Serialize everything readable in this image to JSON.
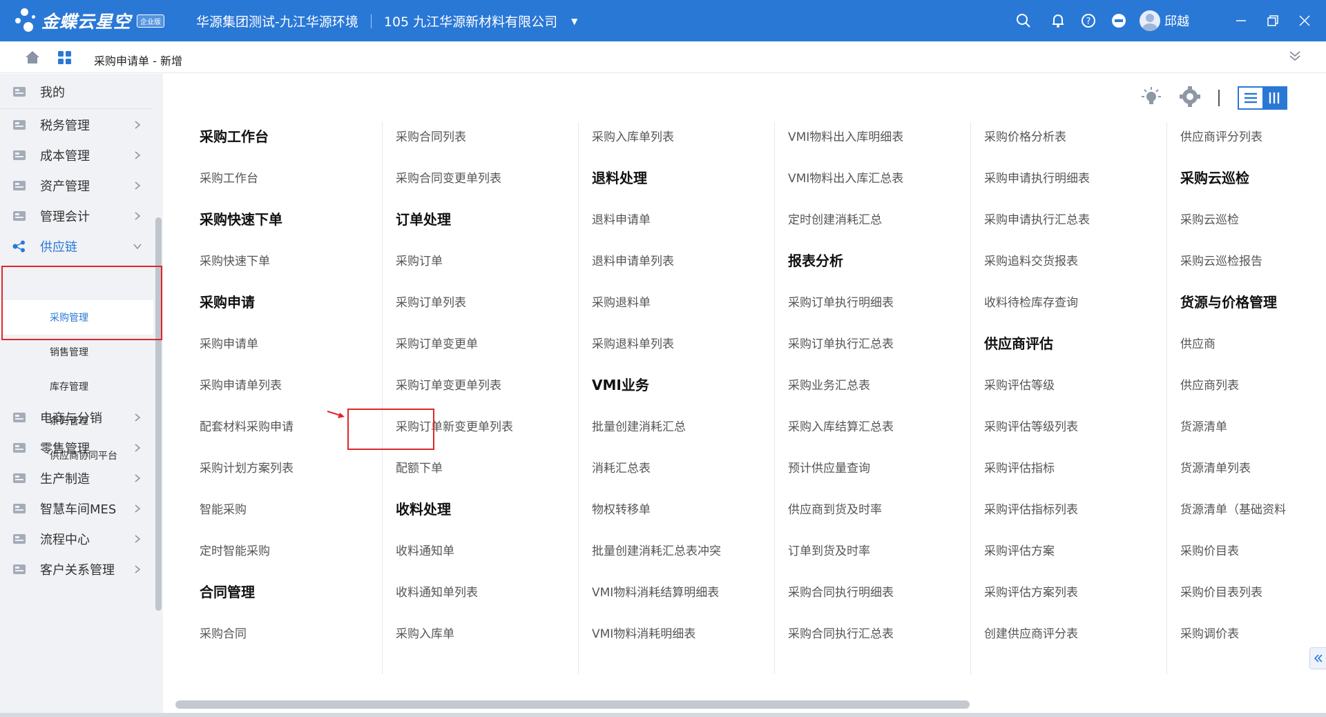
{
  "topbar": {
    "brand": "金蝶云星空",
    "edition": "企业版",
    "tenant": "华源集团测试-九江华源环境",
    "org": "105 九江华源新材料有限公司",
    "user": "邱越"
  },
  "breadcrumb": {
    "title": "采购申请单 - 新增"
  },
  "sidebar": {
    "items": [
      {
        "label": "我的",
        "icon": "user-list-icon"
      },
      {
        "label": "税务管理",
        "icon": "tax-icon"
      },
      {
        "label": "成本管理",
        "icon": "cost-icon"
      },
      {
        "label": "资产管理",
        "icon": "asset-icon"
      },
      {
        "label": "管理会计",
        "icon": "accounting-icon"
      },
      {
        "label": "供应链",
        "icon": "supply-chain-icon"
      },
      {
        "label": "电商与分销",
        "icon": "ecommerce-icon"
      },
      {
        "label": "零售管理",
        "icon": "retail-icon"
      },
      {
        "label": "生产制造",
        "icon": "manufacturing-icon"
      },
      {
        "label": "智慧车间MES",
        "icon": "mes-icon"
      },
      {
        "label": "流程中心",
        "icon": "workflow-icon"
      },
      {
        "label": "客户关系管理",
        "icon": "crm-icon"
      }
    ],
    "subitems": [
      "采购管理",
      "销售管理",
      "库存管理",
      "条码管理",
      "供应商协同平台"
    ]
  },
  "menu": {
    "columns": [
      [
        {
          "t": "h",
          "text": "采购工作台"
        },
        {
          "t": "l",
          "text": "采购工作台"
        },
        {
          "t": "h",
          "text": "采购快速下单"
        },
        {
          "t": "l",
          "text": "采购快速下单"
        },
        {
          "t": "h",
          "text": "采购申请"
        },
        {
          "t": "l",
          "text": "采购申请单"
        },
        {
          "t": "l",
          "text": "采购申请单列表"
        },
        {
          "t": "l",
          "text": "配套材料采购申请"
        },
        {
          "t": "l",
          "text": "采购计划方案列表"
        },
        {
          "t": "l",
          "text": "智能采购"
        },
        {
          "t": "l",
          "text": "定时智能采购"
        },
        {
          "t": "h",
          "text": "合同管理"
        },
        {
          "t": "l",
          "text": "采购合同"
        }
      ],
      [
        {
          "t": "l",
          "text": "采购合同列表"
        },
        {
          "t": "l",
          "text": "采购合同变更单列表"
        },
        {
          "t": "h",
          "text": "订单处理"
        },
        {
          "t": "l",
          "text": "采购订单"
        },
        {
          "t": "l",
          "text": "采购订单列表"
        },
        {
          "t": "l",
          "text": "采购订单变更单"
        },
        {
          "t": "l",
          "text": "采购订单变更单列表"
        },
        {
          "t": "l",
          "text": "采购订单新变更单列表"
        },
        {
          "t": "l",
          "text": "配额下单"
        },
        {
          "t": "h",
          "text": "收料处理"
        },
        {
          "t": "l",
          "text": "收料通知单"
        },
        {
          "t": "l",
          "text": "收料通知单列表"
        },
        {
          "t": "l",
          "text": "采购入库单"
        }
      ],
      [
        {
          "t": "l",
          "text": "采购入库单列表"
        },
        {
          "t": "h",
          "text": "退料处理"
        },
        {
          "t": "l",
          "text": "退料申请单"
        },
        {
          "t": "l",
          "text": "退料申请单列表"
        },
        {
          "t": "l",
          "text": "采购退料单"
        },
        {
          "t": "l",
          "text": "采购退料单列表"
        },
        {
          "t": "h",
          "text": "VMI业务"
        },
        {
          "t": "l",
          "text": "批量创建消耗汇总"
        },
        {
          "t": "l",
          "text": "消耗汇总表"
        },
        {
          "t": "l",
          "text": "物权转移单"
        },
        {
          "t": "l",
          "text": "批量创建消耗汇总表冲突"
        },
        {
          "t": "l",
          "text": "VMI物料消耗结算明细表"
        },
        {
          "t": "l",
          "text": "VMI物料消耗明细表"
        }
      ],
      [
        {
          "t": "l",
          "text": "VMI物料出入库明细表"
        },
        {
          "t": "l",
          "text": "VMI物料出入库汇总表"
        },
        {
          "t": "l",
          "text": "定时创建消耗汇总"
        },
        {
          "t": "h",
          "text": "报表分析"
        },
        {
          "t": "l",
          "text": "采购订单执行明细表"
        },
        {
          "t": "l",
          "text": "采购订单执行汇总表"
        },
        {
          "t": "l",
          "text": "采购业务汇总表"
        },
        {
          "t": "l",
          "text": "采购入库结算汇总表"
        },
        {
          "t": "l",
          "text": "预计供应量查询"
        },
        {
          "t": "l",
          "text": "供应商到货及时率"
        },
        {
          "t": "l",
          "text": "订单到货及时率"
        },
        {
          "t": "l",
          "text": "采购合同执行明细表"
        },
        {
          "t": "l",
          "text": "采购合同执行汇总表"
        }
      ],
      [
        {
          "t": "l",
          "text": "采购价格分析表"
        },
        {
          "t": "l",
          "text": "采购申请执行明细表"
        },
        {
          "t": "l",
          "text": "采购申请执行汇总表"
        },
        {
          "t": "l",
          "text": "采购追料交货报表"
        },
        {
          "t": "l",
          "text": "收料待检库存查询"
        },
        {
          "t": "h",
          "text": "供应商评估"
        },
        {
          "t": "l",
          "text": "采购评估等级"
        },
        {
          "t": "l",
          "text": "采购评估等级列表"
        },
        {
          "t": "l",
          "text": "采购评估指标"
        },
        {
          "t": "l",
          "text": "采购评估指标列表"
        },
        {
          "t": "l",
          "text": "采购评估方案"
        },
        {
          "t": "l",
          "text": "采购评估方案列表"
        },
        {
          "t": "l",
          "text": "创建供应商评分表"
        }
      ],
      [
        {
          "t": "l",
          "text": "供应商评分列表"
        },
        {
          "t": "h",
          "text": "采购云巡检"
        },
        {
          "t": "l",
          "text": "采购云巡检"
        },
        {
          "t": "l",
          "text": "采购云巡检报告"
        },
        {
          "t": "h",
          "text": "货源与价格管理"
        },
        {
          "t": "l",
          "text": "供应商"
        },
        {
          "t": "l",
          "text": "供应商列表"
        },
        {
          "t": "l",
          "text": "货源清单"
        },
        {
          "t": "l",
          "text": "货源清单列表"
        },
        {
          "t": "l",
          "text": "货源清单（基础资料"
        },
        {
          "t": "l",
          "text": "采购价目表"
        },
        {
          "t": "l",
          "text": "采购价目表列表"
        },
        {
          "t": "l",
          "text": "采购调价表"
        }
      ]
    ]
  },
  "colors": {
    "accent": "#2a78d6",
    "highlight": "#e0252b"
  }
}
